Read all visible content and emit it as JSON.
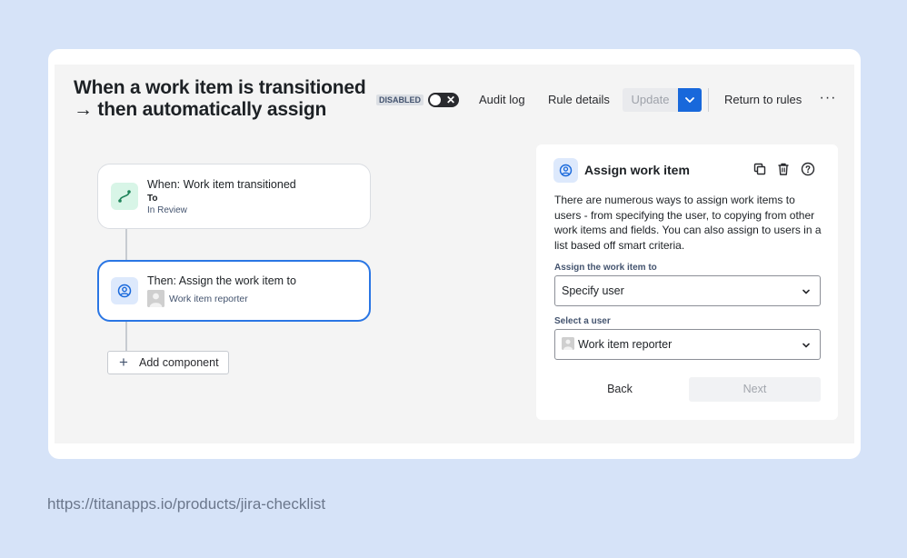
{
  "rule": {
    "title_line1": "When a work item is transitioned",
    "title_line2": "→ then automatically assign"
  },
  "toolbar": {
    "status_badge": "DISABLED",
    "toggle_state": "off",
    "audit_log": "Audit log",
    "rule_details": "Rule details",
    "update": "Update",
    "return_to_rules": "Return to rules",
    "more": "···"
  },
  "flow": {
    "trigger": {
      "title": "When: Work item transitioned",
      "field_label": "To",
      "field_value": "In Review",
      "icon": "transition-icon"
    },
    "action": {
      "title": "Then: Assign the work item to",
      "assignee": "Work item reporter",
      "icon": "user-circle-icon"
    },
    "add_component": "Add component"
  },
  "panel": {
    "title": "Assign work item",
    "icon": "user-circle-icon",
    "actions": [
      "duplicate-icon",
      "trash-icon",
      "help-icon"
    ],
    "description": "There are numerous ways to assign work items to users - from specifying the user, to copying from other work items and fields. You can also assign to users in a list based off smart criteria.",
    "field1_label": "Assign the work item to",
    "field1_value": "Specify user",
    "field2_label": "Select a user",
    "field2_value": "Work item reporter",
    "back": "Back",
    "next": "Next"
  },
  "footer": {
    "url": "https://titanapps.io/products/jira-checklist"
  },
  "colors": {
    "background": "#d6e3f8",
    "accent": "#1868db",
    "node_border_active": "#2a76e4"
  }
}
